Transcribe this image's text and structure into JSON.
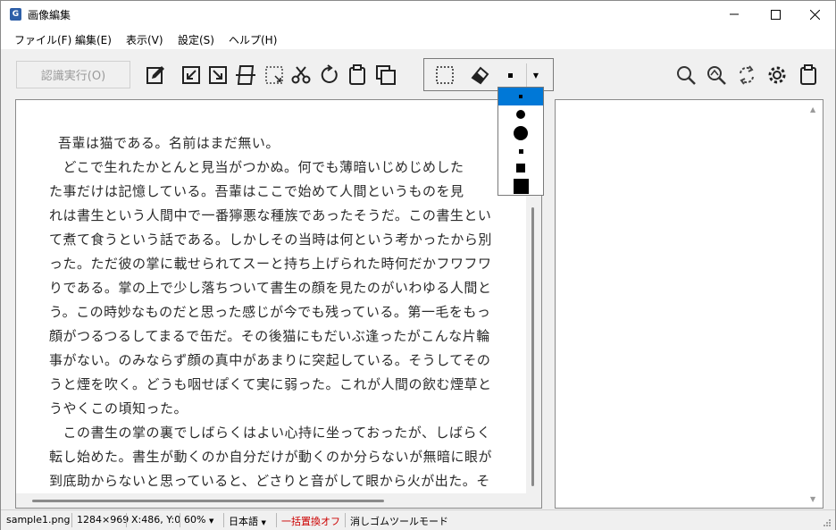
{
  "window": {
    "title": "画像編集",
    "app_icon_letter": "G"
  },
  "menu": [
    {
      "label": "ファイル(F)"
    },
    {
      "label": "編集(E)"
    },
    {
      "label": "表示(V)"
    },
    {
      "label": "設定(S)"
    },
    {
      "label": "ヘルプ(H)"
    }
  ],
  "toolbar": {
    "run_label": "認識実行(O)",
    "icons": [
      "edit-icon",
      "import-left-icon",
      "export-right-icon",
      "perspective-icon",
      "crop-icon",
      "scissors-icon",
      "rotate-icon",
      "clipboard-icon",
      "copy-icon"
    ],
    "right_icons": [
      "zoom-icon",
      "zoom-fit-icon",
      "rotate-view-icon",
      "settings-icon",
      "paste-icon"
    ],
    "tool_group": [
      "rect-select-icon",
      "eraser-icon"
    ]
  },
  "eraser_size": {
    "selected_index": 0,
    "options": [
      "small-square",
      "medium-circle",
      "large-circle",
      "small-square-2",
      "medium-square",
      "large-square"
    ]
  },
  "document": {
    "lines": [
      "吾輩は猫である。名前はまだ無い。",
      "　どこで生れたかとんと見当がつかぬ。何でも薄暗いじめじめした",
      "た事だけは記憶している。吾輩はここで始めて人間というものを見",
      "れは書生という人間中で一番獰悪な種族であったそうだ。この書生とい",
      "て煮て食うという話である。しかしその当時は何という考かったから別",
      "った。ただ彼の掌に載せられてスーと持ち上げられた時何だかフワフワ",
      "りである。掌の上で少し落ちついて書生の顔を見たのがいわゆる人間と",
      "う。この時妙なものだと思った感じが今でも残っている。第一毛をもっ",
      "顔がつるつるしてまるで缶だ。その後猫にもだいぶ逢ったがこんな片輪",
      "事がない。のみならず顔の真中があまりに突起している。そうしてその",
      "うと煙を吹く。どうも咽せぽくて実に弱った。これが人間の飲む煙草と",
      "うやくこの頃知った。",
      "　この書生の掌の裏でしばらくはよい心持に坐っておったが、しばらく",
      "転し始めた。書生が動くのか自分だけが動くのか分らないが無暗に眼が",
      "到底助からないと思っていると、どさりと音がして眼から火が出た。そ"
    ]
  },
  "status": {
    "file": "sample1.png",
    "size": "1284×969",
    "coords": "X:486, Y:0",
    "zoom": "60%",
    "language": "日本語",
    "replace": "一括置換オフ",
    "mode": "消しゴムツールモード",
    "replace_color": "#cc0000"
  },
  "colors": {
    "accent": "#0078d7"
  }
}
